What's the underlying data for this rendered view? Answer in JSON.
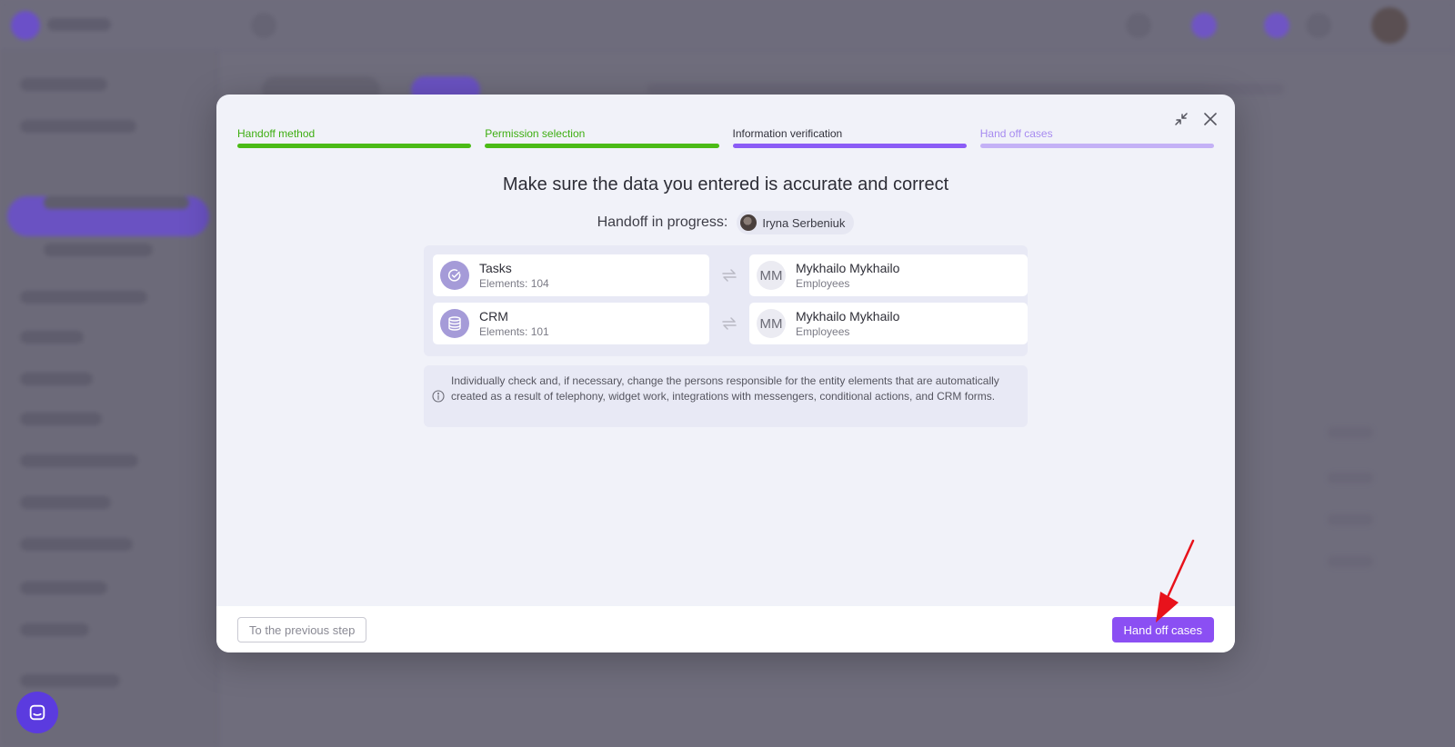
{
  "colors": {
    "overlay": "#6f6d7c",
    "accent": "#8b4ff3",
    "step_done": "#4cbb17",
    "step_active": "#8b5cf6",
    "step_todo": "#c4b1f6",
    "annotation_arrow": "#e8121b"
  },
  "modal": {
    "steps": [
      {
        "label": "Handoff method",
        "state": "done"
      },
      {
        "label": "Permission selection",
        "state": "done"
      },
      {
        "label": "Information verification",
        "state": "active"
      },
      {
        "label": "Hand off cases",
        "state": "todo"
      }
    ],
    "controls": {
      "collapse_icon": "collapse-icon",
      "close_icon": "close-icon"
    },
    "title": "Make sure the data you entered is accurate and correct",
    "progress": {
      "label": "Handoff in progress:",
      "user_name": "Iryna Serbeniuk"
    },
    "entities": [
      {
        "icon": "tasks-check-icon",
        "name": "Tasks",
        "count": "Elements: 104",
        "assignee_initials": "MM",
        "assignee_name": "Mykhailo Mykhailo",
        "assignee_role": "Employees"
      },
      {
        "icon": "crm-database-icon",
        "name": "CRM",
        "count": "Elements: 101",
        "assignee_initials": "MM",
        "assignee_name": "Mykhailo Mykhailo",
        "assignee_role": "Employees"
      }
    ],
    "notice": "Individually check and, if necessary, change the persons responsible for the entity elements that are automatically created as a result of telephony, widget work, integrations with messengers, conditional actions, and CRM forms.",
    "footer": {
      "prev_label": "To the previous step",
      "primary_label": "Hand off cases"
    }
  },
  "chat_widget": {
    "icon": "chat-icon"
  }
}
